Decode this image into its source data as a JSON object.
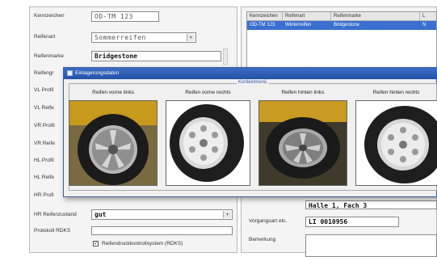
{
  "left_form": {
    "kennzeichen_label": "Kennzeichen",
    "kennzeichen_value": "OD-TM 123",
    "reifenart_label": "Reifenart",
    "reifenart_value": "Sommerreifen",
    "reifenmarke_label": "Reifenmarke",
    "reifenmarke_value": "Bridgestone",
    "reifengr_label": "Reifengr",
    "vl_profil": "VL Profil",
    "vl_reife": "VL Reife",
    "vr_profil": "VR Profil",
    "vr_reife": "VR Reife",
    "hl_profil": "HL Profil",
    "hl_reife": "HL Reife",
    "hr_profil": "HR Profi",
    "hr_zustand_label": "HR Reifenzustand",
    "hr_zustand_value": "gut",
    "rdks_label": "Protokoll RDKS",
    "rdks_checkbox_label": "Reifendruckkontrollsystem (RDKS)"
  },
  "grid": {
    "columns": [
      "Kennzeichen",
      "Reifenart",
      "Reifenmarke",
      "L"
    ],
    "rows": [
      [
        "OD-TM 123",
        "Winterreifen",
        "Bridgestone",
        "N"
      ]
    ]
  },
  "right_form": {
    "lagerort_value": "Halle 1, Fach 3",
    "vorgangsart_label": "Vorgangsart etc.",
    "vorgangsart_value": "LI 0010956",
    "bemerkung_label": "Bemerkung"
  },
  "dialog": {
    "title": "Einlagerungsdaten",
    "group_label": "Kontextmenü",
    "captions": [
      "Reifen vorne links",
      "Reifen vorne rechts",
      "Reifen hinten links",
      "Reifen hinten rechts"
    ]
  },
  "colors": {
    "titlebar": "#2452a8",
    "selection": "#3a6fd0"
  },
  "icons": {
    "dialog_app": "window-icon",
    "dropdown": "chevron-down-icon",
    "checkbox": "checkmark-icon"
  }
}
